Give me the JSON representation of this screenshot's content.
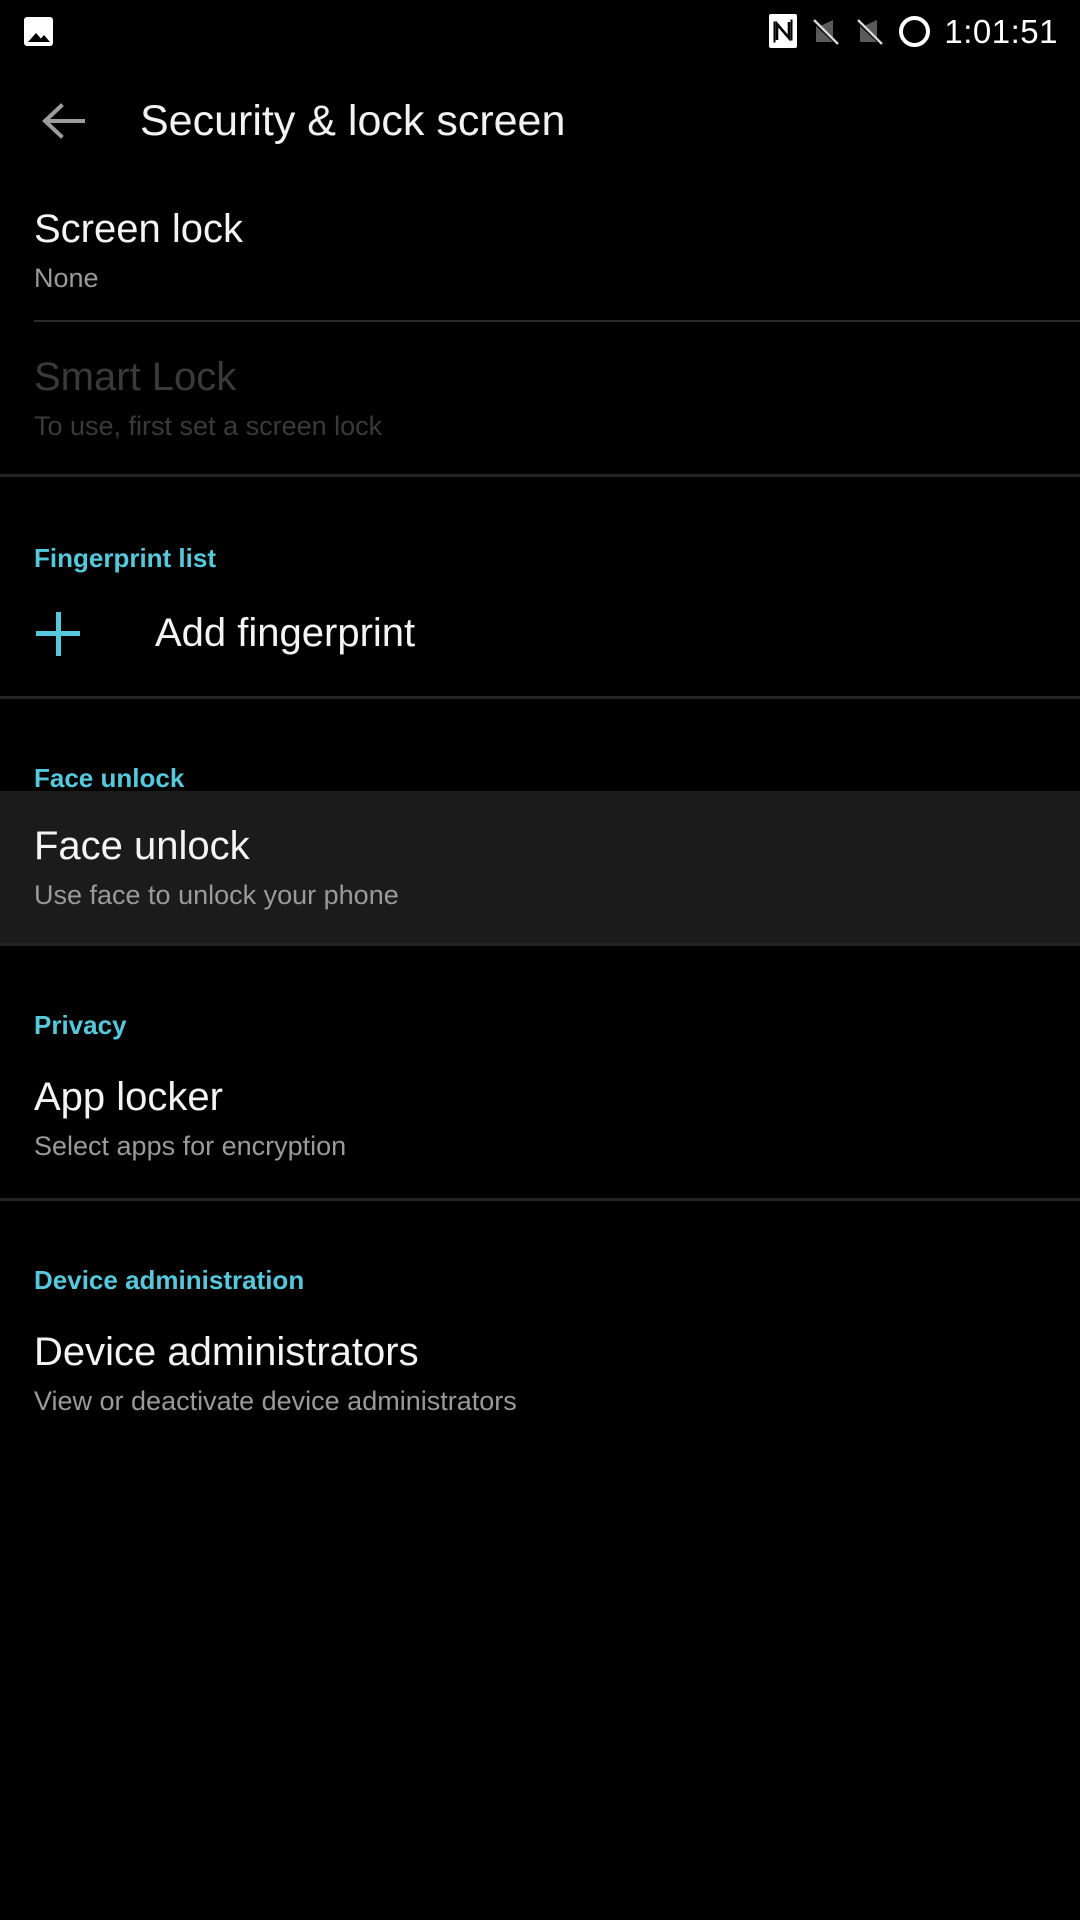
{
  "status_bar": {
    "left_icons": [
      {
        "name": "image-icon",
        "glyph": "image"
      }
    ],
    "right_icons": [
      {
        "name": "nfc-icon",
        "glyph": "nfc"
      },
      {
        "name": "sim1-no-signal-icon",
        "glyph": "signal-off"
      },
      {
        "name": "sim2-no-signal-icon",
        "glyph": "signal-off"
      },
      {
        "name": "screen-recorder-icon",
        "glyph": "ring"
      }
    ],
    "clock": "1:01:51"
  },
  "app_bar": {
    "back_label": "Back",
    "title": "Security & lock screen"
  },
  "theme": {
    "background": "#000000",
    "accent": "#56c8dc",
    "primary_text": "#f4f4f4",
    "secondary_text": "#9a9a9a",
    "disabled_text": "#3a3a3a",
    "highlight_background": "#1b1b1b",
    "divider": "#2b2b2b"
  },
  "sections": [
    {
      "id": "screen-lock-group",
      "header": null,
      "rows": [
        {
          "id": "screen-lock",
          "title": "Screen lock",
          "summary": "None",
          "disabled": false,
          "highlighted": false
        },
        {
          "id": "smart-lock",
          "title": "Smart Lock",
          "summary": "To use, first set a screen lock",
          "disabled": true,
          "highlighted": false
        }
      ]
    },
    {
      "id": "fingerprint-group",
      "header": "Fingerprint list",
      "action": {
        "id": "add-fingerprint",
        "label": "Add fingerprint",
        "icon": "plus-icon"
      }
    },
    {
      "id": "face-unlock-group",
      "header": "Face unlock",
      "rows": [
        {
          "id": "face-unlock",
          "title": "Face unlock",
          "summary": "Use face to unlock your phone",
          "disabled": false,
          "highlighted": true
        }
      ]
    },
    {
      "id": "privacy-group",
      "header": "Privacy",
      "rows": [
        {
          "id": "app-locker",
          "title": "App locker",
          "summary": "Select apps for encryption",
          "disabled": false,
          "highlighted": false
        }
      ]
    },
    {
      "id": "device-administration-group",
      "header": "Device administration",
      "rows": [
        {
          "id": "device-administrators",
          "title": "Device administrators",
          "summary": "View or deactivate device administrators",
          "disabled": false,
          "highlighted": false
        }
      ]
    }
  ]
}
